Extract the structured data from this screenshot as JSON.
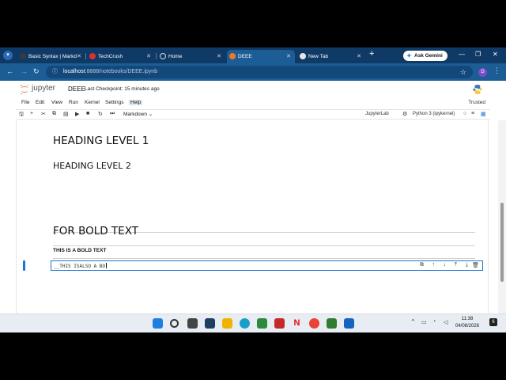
{
  "browser": {
    "tabs": [
      {
        "label": "Basic Syntax | Markd",
        "icon": "markdown-guide-icon"
      },
      {
        "label": "TechCrush",
        "icon": "techcrush-icon"
      },
      {
        "label": "Home",
        "icon": "jupyter-loading-icon"
      },
      {
        "label": "DEEE",
        "icon": "jupyter-icon",
        "active": true
      },
      {
        "label": "New Tab",
        "icon": "chrome-icon"
      }
    ],
    "ask_gemini": "Ask Gemini",
    "url_host": "localhost",
    "url_path": ":8888/notebooks/DEEE.ipynb",
    "profile_initial": "D"
  },
  "jupyter": {
    "logo_text": "jupyter",
    "notebook_name": "DEEE",
    "checkpoint": "Last Checkpoint: 15 minutes ago",
    "menu": [
      "File",
      "Edit",
      "View",
      "Run",
      "Kernel",
      "Settings",
      "Help"
    ],
    "trusted": "Trusted",
    "cell_type": "Markdown",
    "jupyterlab_link": "JupyterLab",
    "kernel": "Python 3 (ipykernel)"
  },
  "notebook": {
    "h1": "HEADING LEVEL 1",
    "h2": "HEADING LEVEL 2",
    "h1_bold": "FOR BOLD TEXT",
    "bold_paragraph": "THIS IS A BOLD TEXT",
    "editing_cell_text": "__THIS ISALSO A BO"
  },
  "taskbar": {
    "time": "11:38",
    "date": "04/08/2026"
  },
  "colors": {
    "tabstrip": "#0f3a66",
    "toolbar": "#1c5d96",
    "accent": "#1976d2",
    "jupyter_orange": "#f37726"
  }
}
